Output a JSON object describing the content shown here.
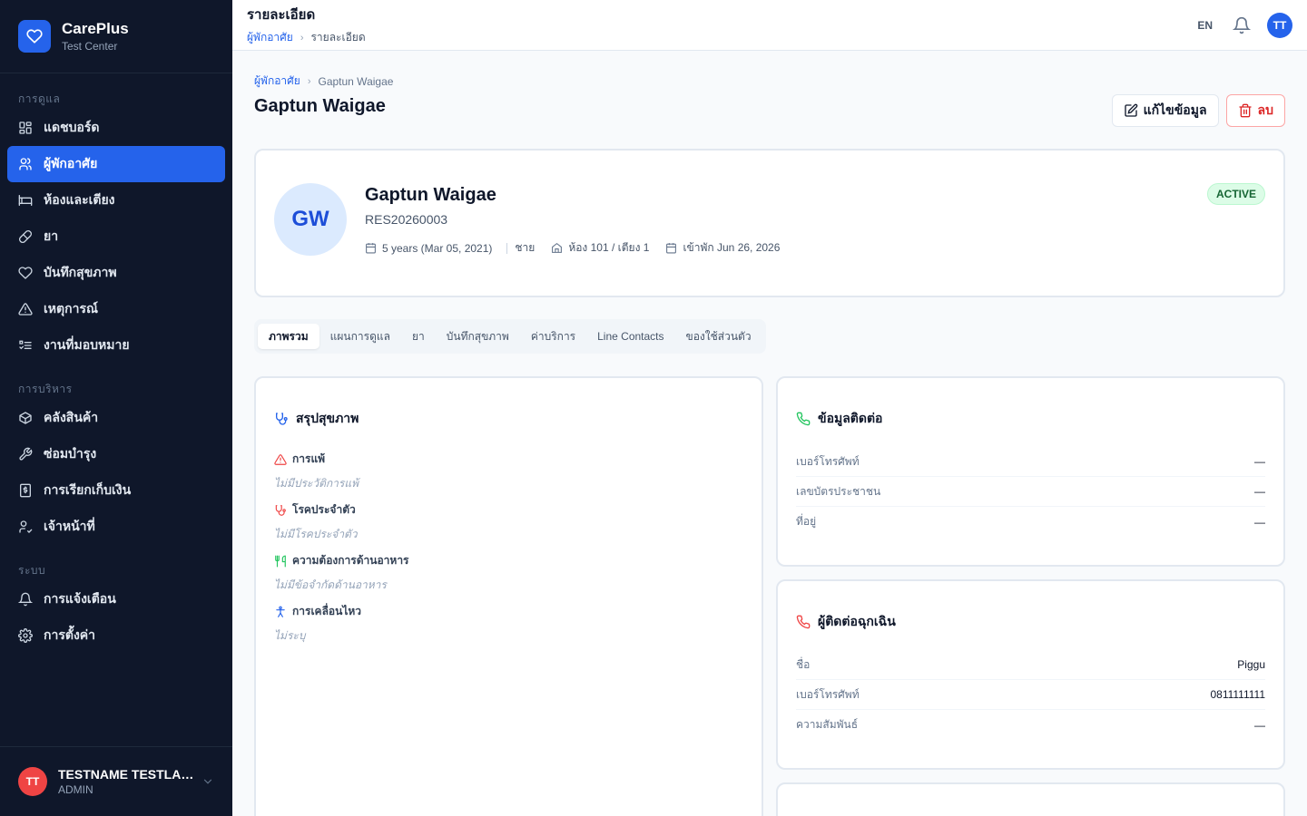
{
  "brand": {
    "name": "CarePlus",
    "subtitle": "Test Center"
  },
  "sidebar": {
    "section_care": "การดูแล",
    "items_care": [
      {
        "label": "แดชบอร์ด",
        "icon": "dashboard-icon"
      },
      {
        "label": "ผู้พักอาศัย",
        "icon": "users-icon",
        "active": true
      },
      {
        "label": "ห้องและเตียง",
        "icon": "bed-icon"
      },
      {
        "label": "ยา",
        "icon": "pill-icon"
      },
      {
        "label": "บันทึกสุขภาพ",
        "icon": "heart-icon"
      },
      {
        "label": "เหตุการณ์",
        "icon": "alert-icon"
      },
      {
        "label": "งานที่มอบหมาย",
        "icon": "tasks-icon"
      }
    ],
    "section_admin": "การบริหาร",
    "items_admin": [
      {
        "label": "คลังสินค้า",
        "icon": "package-icon"
      },
      {
        "label": "ซ่อมบำรุง",
        "icon": "wrench-icon"
      },
      {
        "label": "การเรียกเก็บเงิน",
        "icon": "billing-icon"
      },
      {
        "label": "เจ้าหน้าที่",
        "icon": "staff-icon"
      }
    ],
    "section_system": "ระบบ",
    "items_system": [
      {
        "label": "การแจ้งเตือน",
        "icon": "bell-icon"
      },
      {
        "label": "การตั้งค่า",
        "icon": "gear-icon"
      }
    ]
  },
  "user": {
    "initials": "TT",
    "name": "TESTNAME TESTLASTNAME",
    "role": "ADMIN"
  },
  "topbar": {
    "title": "รายละเอียด",
    "crumb_parent": "ผู้พักอาศัย",
    "crumb_current": "รายละเอียด",
    "lang": "EN",
    "avatar": "TT"
  },
  "page": {
    "crumb_parent": "ผู้พักอาศัย",
    "crumb_current": "Gaptun Waigae",
    "title": "Gaptun Waigae",
    "edit_label": "แก้ไขข้อมูล",
    "delete_label": "ลบ"
  },
  "profile": {
    "initials": "GW",
    "name": "Gaptun Waigae",
    "resident_id": "RES20260003",
    "age": "5 years (Mar 05, 2021)",
    "gender": "ชาย",
    "room": "ห้อง 101 / เตียง 1",
    "admitted": "เข้าพัก Jun 26, 2026",
    "status": "ACTIVE",
    "status_color": "#dcfce7"
  },
  "tabs": [
    "ภาพรวม",
    "แผนการดูแล",
    "ยา",
    "บันทึกสุขภาพ",
    "ค่าบริการ",
    "Line Contacts",
    "ของใช้ส่วนตัว"
  ],
  "summary": {
    "title": "สรุปสุขภาพ",
    "items": [
      {
        "label": "การแพ้",
        "value": "ไม่มีประวัติการแพ้",
        "icon": "warning-icon",
        "color": "#ef4444"
      },
      {
        "label": "โรคประจำตัว",
        "value": "ไม่มีโรคประจำตัว",
        "icon": "stethoscope-icon",
        "color": "#ef4444"
      },
      {
        "label": "ความต้องการด้านอาหาร",
        "value": "ไม่มีข้อจำกัดด้านอาหาร",
        "icon": "utensils-icon",
        "color": "#22c55e"
      },
      {
        "label": "การเคลื่อนไหว",
        "value": "ไม่ระบุ",
        "icon": "accessibility-icon",
        "color": "#2563eb"
      }
    ]
  },
  "contact": {
    "title": "ข้อมูลติดต่อ",
    "rows": [
      {
        "key": "เบอร์โทรศัพท์",
        "value": "—"
      },
      {
        "key": "เลขบัตรประชาชน",
        "value": "—"
      },
      {
        "key": "ที่อยู่",
        "value": "—"
      }
    ]
  },
  "emergency": {
    "title": "ผู้ติดต่อฉุกเฉิน",
    "rows": [
      {
        "key": "ชื่อ",
        "value": "Piggu"
      },
      {
        "key": "เบอร์โทรศัพท์",
        "value": "0811111111"
      },
      {
        "key": "ความสัมพันธ์",
        "value": "—"
      }
    ]
  },
  "colors": {
    "sidebar_bg": "#0f172a",
    "accent": "#2563eb",
    "danger": "#dc2626"
  }
}
